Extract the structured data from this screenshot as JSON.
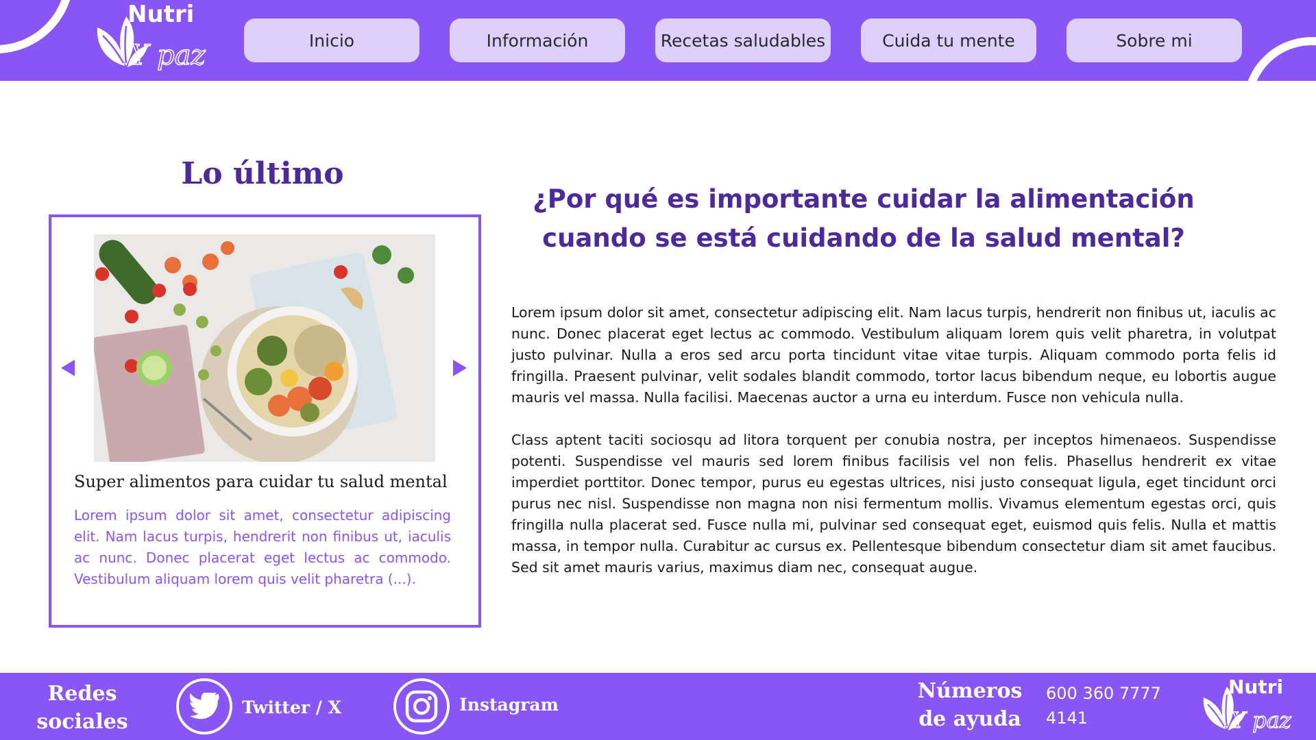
{
  "header": {
    "logo_text_top": "Nutri",
    "logo_text_script": "Y paz",
    "nav": [
      {
        "label": "Inicio"
      },
      {
        "label": "Información"
      },
      {
        "label": "Recetas saludables"
      },
      {
        "label": "Cuida tu mente"
      },
      {
        "label": "Sobre mi"
      }
    ]
  },
  "latest": {
    "heading": "Lo último",
    "card_title": "Super alimentos para cuidar tu salud mental",
    "card_text": "Lorem ipsum dolor sit amet, consectetur adipiscing elit. Nam lacus turpis, hendrerit non finibus ut, iaculis ac nunc. Donec placerat eget lectus ac commodo. Vestibulum aliquam lorem quis velit pharetra (...)."
  },
  "article": {
    "title": "¿Por qué es importante cuidar la alimentación cuando se está cuidando de la salud mental?",
    "paragraph_1": "Lorem ipsum dolor sit amet, consectetur adipiscing elit. Nam lacus turpis, hendrerit non finibus ut, iaculis ac nunc. Donec placerat eget lectus ac commodo. Vestibulum aliquam lorem quis velit pharetra, in volutpat justo pulvinar. Nulla a eros sed arcu porta tincidunt vitae vitae turpis. Aliquam commodo porta felis id fringilla. Praesent pulvinar, velit sodales blandit commodo, tortor lacus bibendum neque, eu lobortis augue mauris vel massa. Nulla facilisi. Maecenas auctor a urna eu interdum. Fusce non vehicula nulla.",
    "paragraph_2": "Class aptent taciti sociosqu ad litora torquent per conubia nostra, per inceptos himenaeos. Suspendisse potenti. Suspendisse vel mauris sed lorem finibus facilisis vel non felis. Phasellus hendrerit ex vitae imperdiet porttitor. Donec tempor, purus eu egestas ultrices, nisi justo consequat ligula, eget tincidunt orci purus nec nisl. Suspendisse non magna non nisi fermentum mollis. Vivamus elementum egestas orci, quis fringilla nulla placerat sed. Fusce nulla mi, pulvinar sed consequat eget, euismod quis felis. Nulla et mattis massa, in tempor nulla. Curabitur ac cursus ex. Pellentesque bibendum consectetur diam sit amet faucibus. Sed sit amet mauris varius, maximus diam nec, consequat augue."
  },
  "footer": {
    "social_title": "Redes sociales",
    "twitter_label": "Twitter / X",
    "instagram_label": "Instagram",
    "help_title": "Números de ayuda",
    "phone_1": "600 360 7777",
    "phone_2": "4141"
  },
  "colors": {
    "brand_purple": "#8a55f5",
    "heading_purple": "#4c2a9e",
    "nav_button": "#ddd0fd"
  },
  "icons": [
    "leaf-logo-icon",
    "chevron-left-icon",
    "chevron-right-icon",
    "twitter-icon",
    "instagram-icon"
  ]
}
